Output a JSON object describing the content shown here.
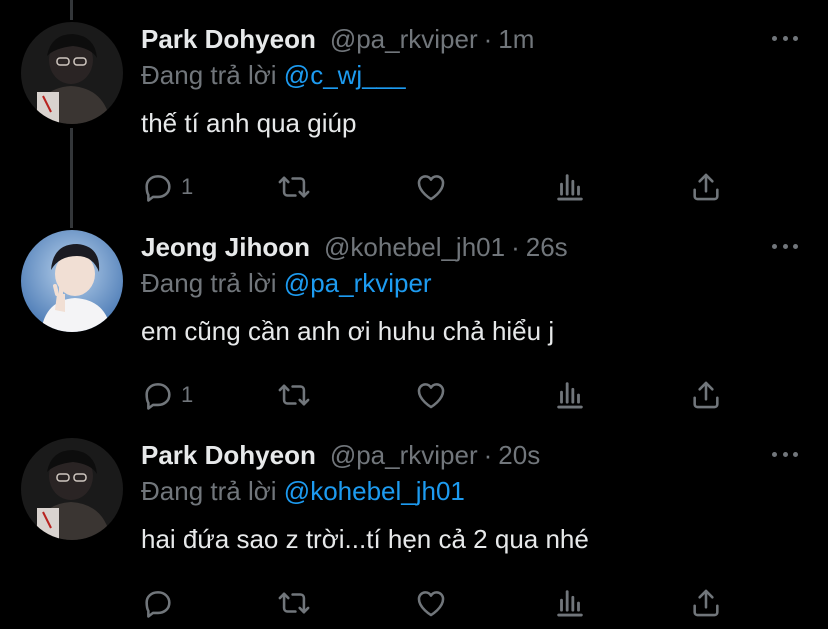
{
  "tweets": [
    {
      "name": "Park Dohyeon",
      "handle": "@pa_rkviper",
      "dot": "·",
      "time": "1m",
      "reply_label": "Đang trả lời",
      "reply_mention": "@c_wj___",
      "text": "thế tí anh qua giúp",
      "reply_count": "1",
      "avatar": "avatar-park-dohyeon"
    },
    {
      "name": "Jeong Jihoon",
      "handle": "@kohebel_jh01",
      "dot": "·",
      "time": "26s",
      "reply_label": "Đang trả lời",
      "reply_mention": "@pa_rkviper",
      "text": "em cũng cần anh ơi huhu chả hiểu j",
      "reply_count": "1",
      "avatar": "avatar-jeong-jihoon"
    },
    {
      "name": "Park Dohyeon",
      "handle": "@pa_rkviper",
      "dot": "·",
      "time": "20s",
      "reply_label": "Đang trả lời",
      "reply_mention": "@kohebel_jh01",
      "text": "hai đứa sao z trời...tí hẹn cả 2 qua nhé",
      "reply_count": "",
      "avatar": "avatar-park-dohyeon"
    }
  ],
  "icons": {
    "reply": "reply-icon",
    "retweet": "retweet-icon",
    "like": "heart-icon",
    "views": "views-icon",
    "share": "share-icon",
    "more": "more-icon"
  },
  "colors": {
    "background": "#000000",
    "text": "#e7e9ea",
    "secondary": "#71767b",
    "link": "#1d9bf0",
    "thread_line": "#333639"
  }
}
